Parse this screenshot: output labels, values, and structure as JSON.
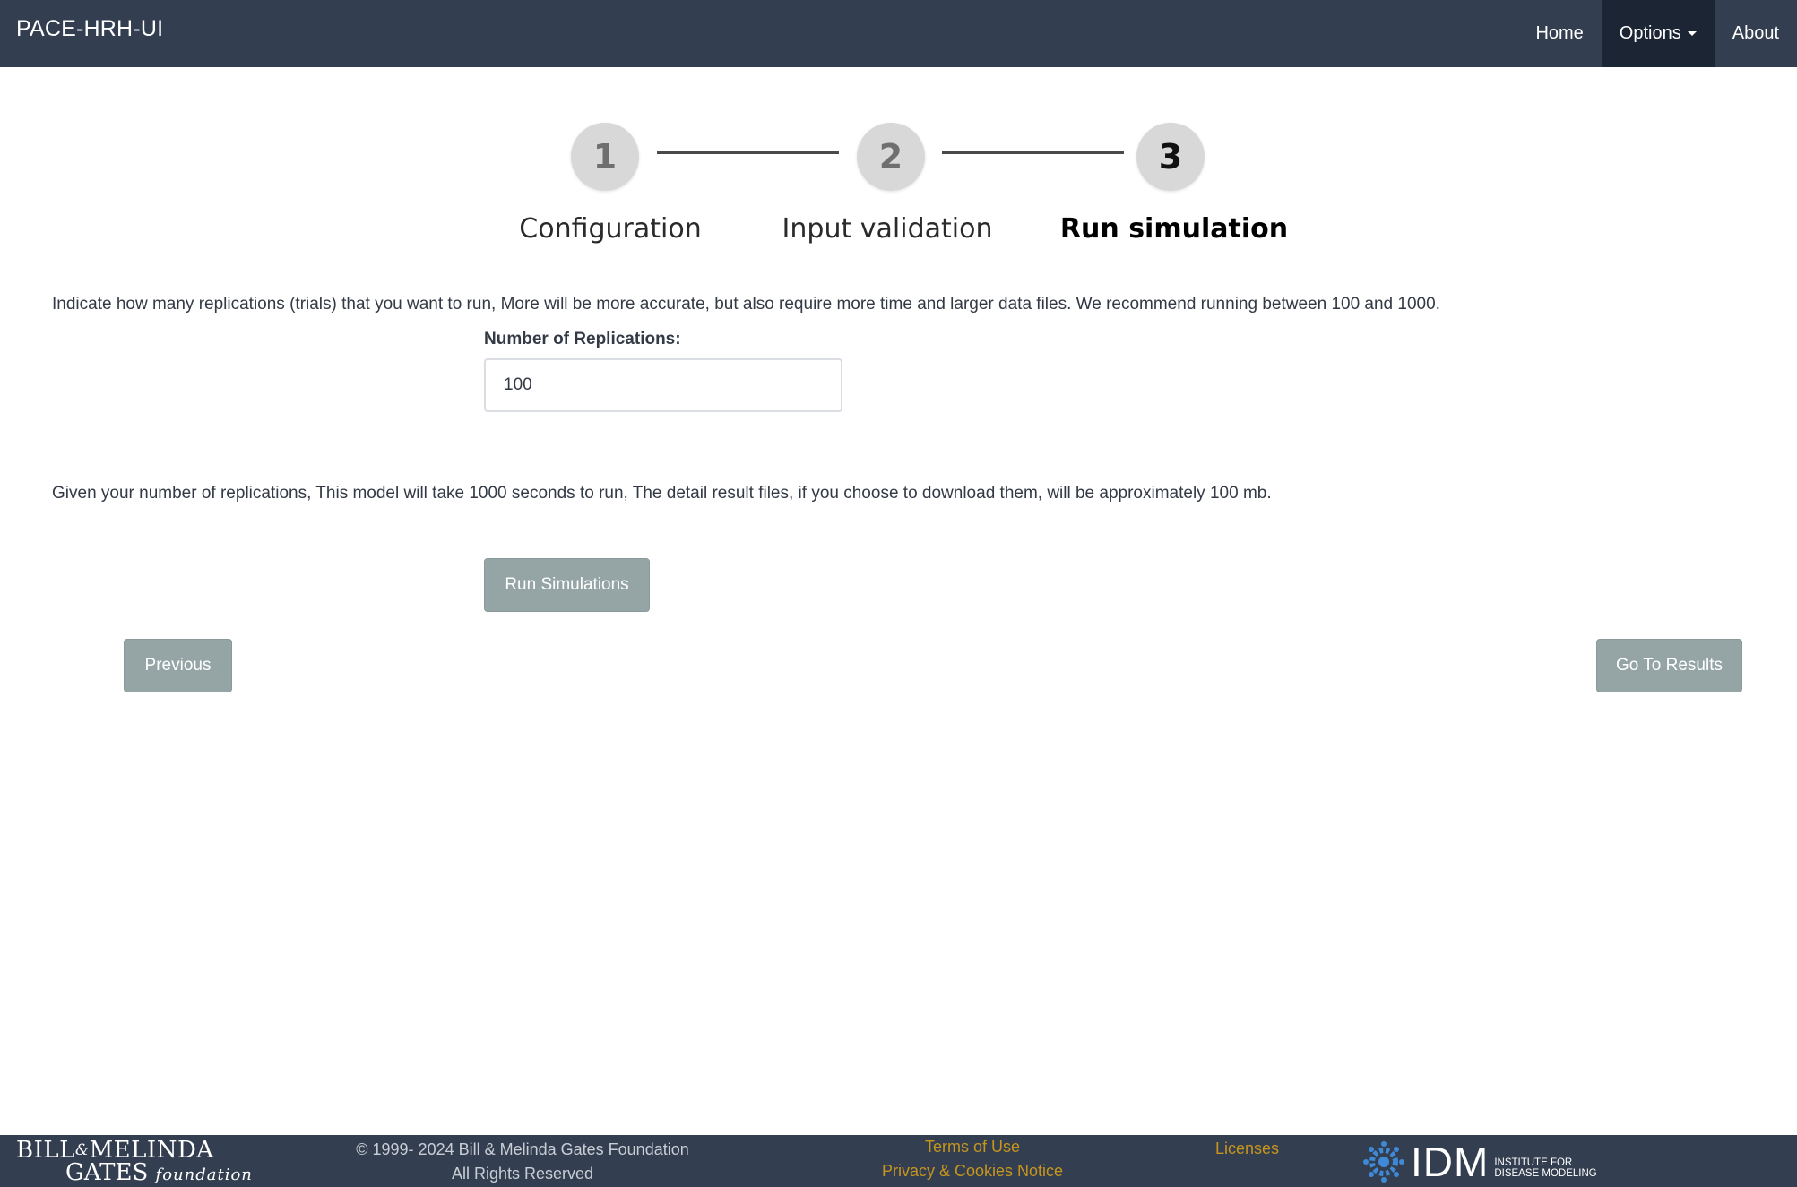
{
  "navbar": {
    "brand": "PACE-HRH-UI",
    "items": [
      {
        "label": "Home"
      },
      {
        "label": "Options"
      },
      {
        "label": "About"
      }
    ]
  },
  "stepper": {
    "steps": [
      {
        "number": "1",
        "label": "Configuration"
      },
      {
        "number": "2",
        "label": "Input validation"
      },
      {
        "number": "3",
        "label": "Run simulation"
      }
    ],
    "current_step": 3
  },
  "main": {
    "intro_text": "Indicate how many replications (trials) that you want to run, More will be more accurate, but also require more time and larger data files. We recommend running between 100 and 1000.",
    "replications_label": "Number of Replications:",
    "replications_value": "100",
    "estimate_text": "Given your number of replications, This model will take 1000 seconds to run, The detail result files, if you choose to download them, will be approximately 100 mb.",
    "run_button": "Run Simulations",
    "previous_button": "Previous",
    "results_button": "Go To Results"
  },
  "footer": {
    "gates_logo": {
      "line1_a": "BILL",
      "amp": "&",
      "line1_b": "MELINDA",
      "line2_a": "GATES",
      "line2_b": "foundation"
    },
    "copyright_line1": "© 1999- 2024 Bill & Melinda Gates Foundation",
    "copyright_line2": "All Rights Reserved",
    "terms_link": "Terms of Use",
    "privacy_link": "Privacy & Cookies Notice",
    "licenses_link": "Licenses",
    "idm_logo": {
      "text": "IDM",
      "sub_line1": "INSTITUTE FOR",
      "sub_line2": "DISEASE MODELING"
    }
  },
  "colors": {
    "navbar_bg": "#333f50",
    "nav_active_bg": "#1c2533",
    "button_bg": "#95a5a6",
    "footer_link": "#c7951c",
    "idm_blue": "#3f8ad6"
  }
}
